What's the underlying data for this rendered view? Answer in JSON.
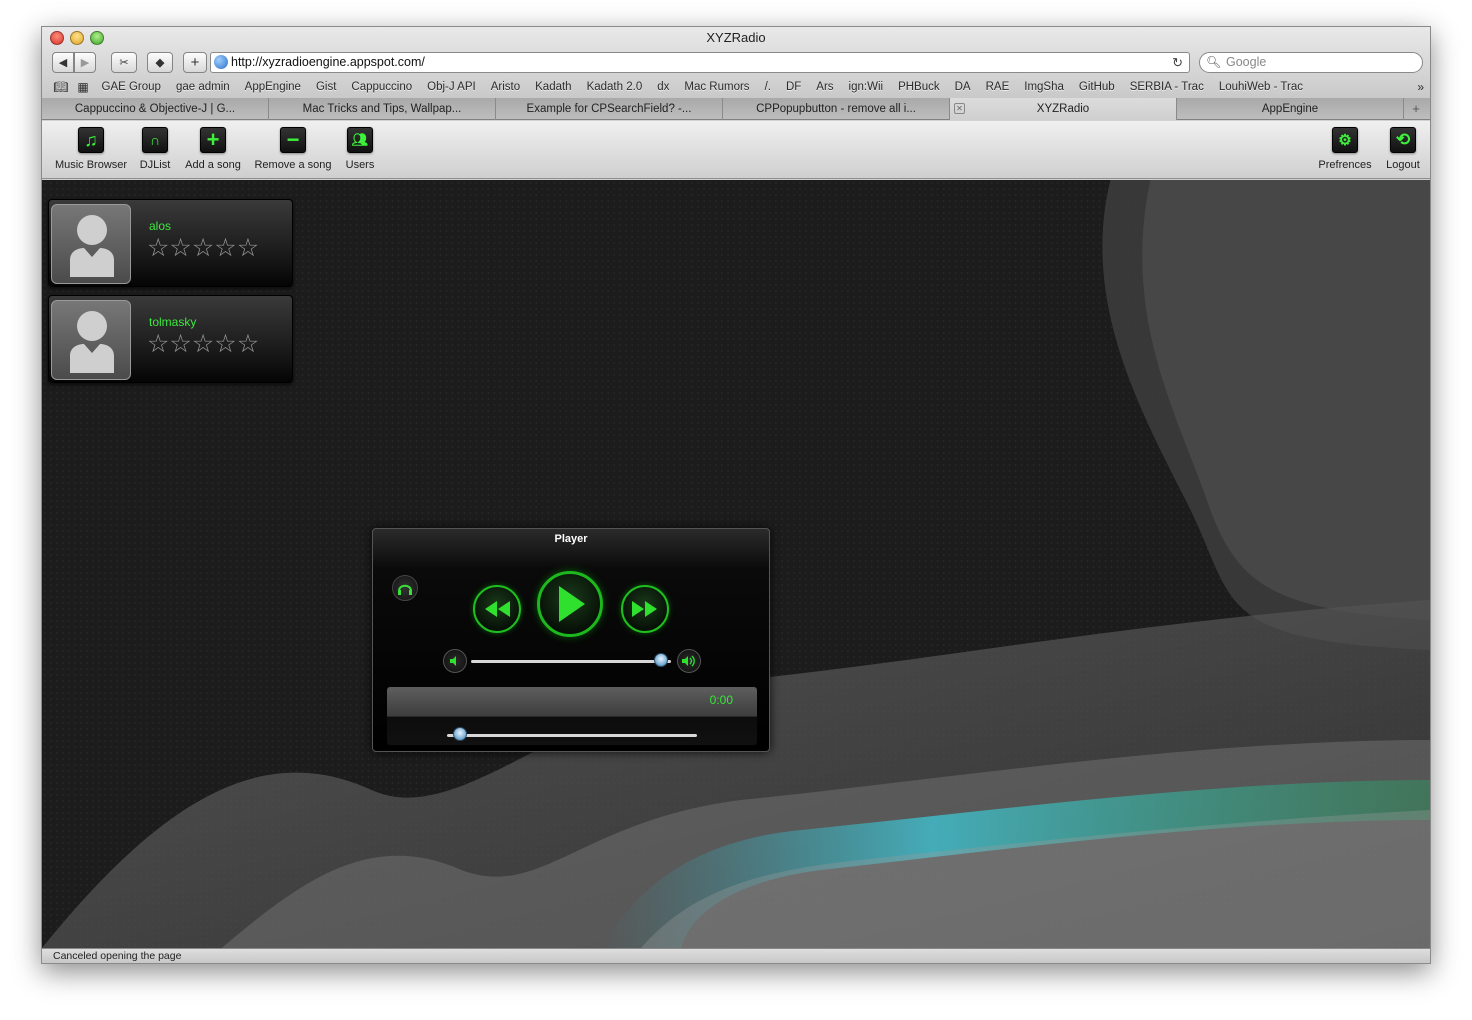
{
  "window": {
    "title": "XYZRadio"
  },
  "address_bar": {
    "url": "http://xyzradioengine.appspot.com/",
    "search_placeholder": "Google"
  },
  "bookmarks": [
    "GAE Group",
    "gae admin",
    "AppEngine",
    "Gist",
    "Cappuccino",
    "Obj-J API",
    "Aristo",
    "Kadath",
    "Kadath 2.0",
    "dx",
    "Mac Rumors",
    "/.",
    "DF",
    "Ars",
    "ign:Wii",
    "PHBuck",
    "DA",
    "RAE",
    "ImgSha",
    "GitHub",
    "SERBIA - Trac",
    "LouhiWeb - Trac"
  ],
  "tabs": [
    {
      "label": "Cappuccino & Objective-J | G...",
      "active": false
    },
    {
      "label": "Mac Tricks and Tips, Wallpap...",
      "active": false
    },
    {
      "label": "Example for CPSearchField? -...",
      "active": false
    },
    {
      "label": "CPPopupbutton - remove all i...",
      "active": false
    },
    {
      "label": "XYZRadio",
      "active": true
    },
    {
      "label": "AppEngine",
      "active": false
    }
  ],
  "toolbar": {
    "music_browser": "Music Browser",
    "djlist": "DJList",
    "add_song": "Add a song",
    "remove_song": "Remove a song",
    "users": "Users",
    "preferences": "Prefrences",
    "logout": "Logout"
  },
  "users": [
    {
      "name": "alos",
      "rating": 0,
      "max_rating": 5
    },
    {
      "name": "tolmasky",
      "rating": 0,
      "max_rating": 5
    }
  ],
  "player": {
    "title": "Player",
    "time": "0:00",
    "volume": 0.95,
    "position": 0.05
  },
  "status": "Canceled opening the page",
  "colors": {
    "accent_green": "#3ce83c",
    "background": "#1b1b1b"
  }
}
